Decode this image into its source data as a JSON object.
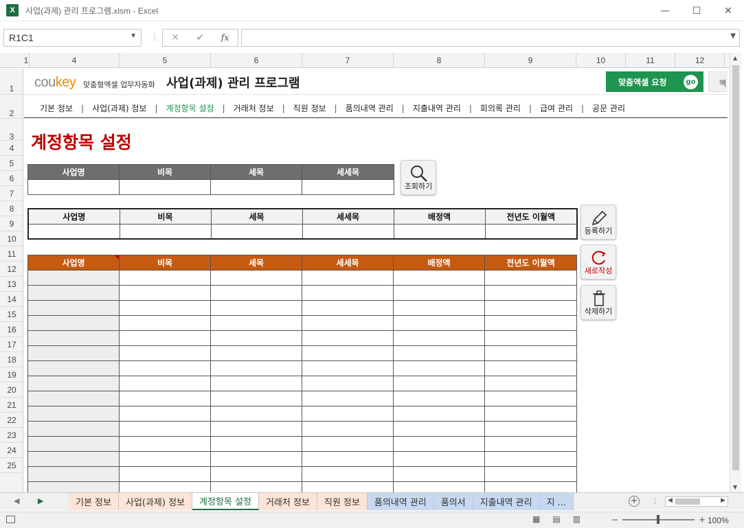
{
  "window": {
    "app_icon": "X",
    "title": "사업(과제) 관리 프로그램.xlsm - Excel",
    "minimize_icon": "—",
    "maximize_icon": "☐",
    "close_icon": "✕"
  },
  "formula_bar": {
    "name_box": "R1C1",
    "cancel_symbol": "✕",
    "enter_symbol": "✔",
    "fx_symbol": "fx",
    "formula": ""
  },
  "columns": [
    "1",
    "4",
    "5",
    "6",
    "7",
    "8",
    "9",
    "10",
    "11",
    "12"
  ],
  "rows": [
    "1",
    "2",
    "3",
    "4",
    "5",
    "6",
    "7",
    "8",
    "9",
    "10",
    "11",
    "12",
    "13",
    "14",
    "15",
    "16",
    "17",
    "18",
    "19",
    "20",
    "21",
    "22",
    "23",
    "24",
    "25"
  ],
  "header": {
    "logo_main": "cou",
    "logo_accent": "key",
    "logo_sub": "맞춤형엑셀 업무자동화",
    "app_title": "사업(과제) 관리 프로그램",
    "request_button": "맞춤엑셀 요청",
    "go_badge": "go",
    "side_tag": "엑"
  },
  "nav": [
    {
      "label": "기본 정보",
      "active": false
    },
    {
      "label": "사업(과제) 정보",
      "active": false
    },
    {
      "label": "계정항목 설정",
      "active": true
    },
    {
      "label": "거래처 정보",
      "active": false
    },
    {
      "label": "직원 정보",
      "active": false
    },
    {
      "label": "품의내역 관리",
      "active": false
    },
    {
      "label": "지출내역 관리",
      "active": false
    },
    {
      "label": "회의록 관리",
      "active": false
    },
    {
      "label": "급여 관리",
      "active": false
    },
    {
      "label": "공문 관리",
      "active": false
    }
  ],
  "nav_separator": "|",
  "page_heading": "계정항목 설정",
  "search_table": {
    "headers": [
      "사업명",
      "비목",
      "세목",
      "세세목"
    ]
  },
  "form_table": {
    "headers": [
      "사업명",
      "비목",
      "세목",
      "세세목",
      "배정액",
      "전년도 이월액"
    ]
  },
  "list_table": {
    "headers": [
      "사업명",
      "비목",
      "세목",
      "세세목",
      "배정액",
      "전년도 이월액"
    ],
    "row_count": 15
  },
  "buttons": {
    "search": "조회하기",
    "register": "등록하기",
    "new": "새로작성",
    "delete": "삭제하기"
  },
  "sheet_tabs": [
    {
      "label": "기본 정보",
      "color": "#fce4d6",
      "active": false
    },
    {
      "label": "사업(과제) 정보",
      "color": "#fce4d6",
      "active": false
    },
    {
      "label": "계정항목 설정",
      "color": "#ffffff",
      "active": true
    },
    {
      "label": "거래처 정보",
      "color": "#fce4d6",
      "active": false
    },
    {
      "label": "직원 정보",
      "color": "#fce4d6",
      "active": false
    },
    {
      "label": "품의내역 관리",
      "color": "#c6d9f0",
      "active": false
    },
    {
      "label": "품의서",
      "color": "#c6d9f0",
      "active": false
    },
    {
      "label": "지출내역 관리",
      "color": "#c6d9f0",
      "active": false
    },
    {
      "label": "지 ...",
      "color": "#c6d9f0",
      "active": false
    }
  ],
  "tab_add_symbol": "+",
  "status": {
    "zoom_minus": "−",
    "zoom_plus": "+",
    "zoom": "100%"
  },
  "colors": {
    "heading_red": "#c00000",
    "accent_green": "#1e9450",
    "list_header_orange": "#c55a11",
    "search_header_gray": "#6e6e6e"
  }
}
